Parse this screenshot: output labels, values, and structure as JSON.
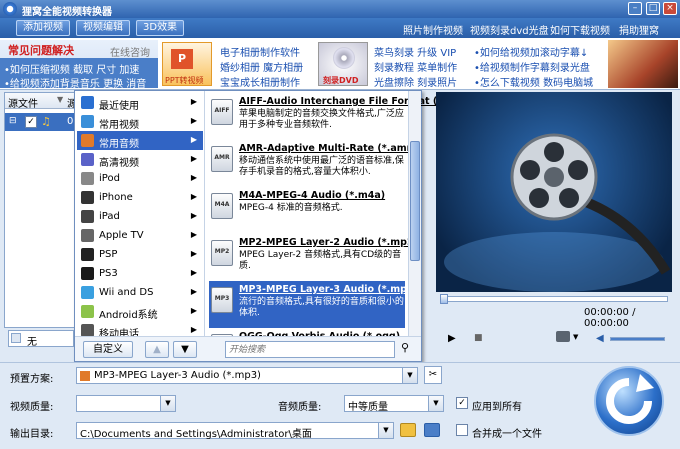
{
  "window": {
    "title": "狸窝全能视频转换器"
  },
  "menubar": {
    "tabs": [
      "添加视频",
      "视频编辑",
      "3D效果"
    ],
    "links": [
      "照片制作视频",
      "视频刻录dvd光盘",
      "如何下载视频",
      "捐助狸窝"
    ]
  },
  "ads": {
    "faq_title": "常见问题解决",
    "online": "在线咨询",
    "faq_lines": [
      "•如何压缩视频  截取  尺寸  加速",
      "•给视频添加背景音乐  更换  消音"
    ],
    "ppt_label": "PPT转视频",
    "mid_lines": [
      "电子相册制作软件",
      "婚纱相册  魔方相册",
      "宝宝成长相册制作"
    ],
    "dvd_label": "刻录DVD",
    "right_lines": [
      "菜鸟刻录  升级 VIP",
      "刻录教程  菜单制作",
      "光盘擦除  刻录照片"
    ],
    "far_lines": [
      "•如何给视频加滚动字幕↓",
      "•给视频制作字幕刻录光盘",
      "•怎么下载视频  数码电脑城"
    ]
  },
  "filelist": {
    "col1": "源文件",
    "col2": "源",
    "row_num": "0"
  },
  "subtitle": {
    "value": "无"
  },
  "categories": [
    {
      "label": "最近使用",
      "icon": "clock-icon"
    },
    {
      "label": "常用视频",
      "icon": "video-icon"
    },
    {
      "label": "常用音频",
      "icon": "audio-icon",
      "selected": true
    },
    {
      "label": "高清视频",
      "icon": "hd-icon"
    },
    {
      "label": "iPod",
      "icon": "ipod-icon"
    },
    {
      "label": "iPhone",
      "icon": "iphone-icon"
    },
    {
      "label": "iPad",
      "icon": "ipad-icon"
    },
    {
      "label": "Apple TV",
      "icon": "appletv-icon"
    },
    {
      "label": "PSP",
      "icon": "psp-icon"
    },
    {
      "label": "PS3",
      "icon": "ps3-icon"
    },
    {
      "label": "Wii and DS",
      "icon": "wii-icon"
    },
    {
      "label": "Android系统",
      "icon": "android-icon"
    },
    {
      "label": "移动电话",
      "icon": "phone-icon"
    }
  ],
  "formats": [
    {
      "badge": "AIFF",
      "title": "AIFF-Audio Interchange File Format (*.aiff)",
      "desc": "苹果电脑制定的音频交换文件格式,广泛应用于多种专业音频软件."
    },
    {
      "badge": "AMR",
      "title": "AMR-Adaptive Multi-Rate (*.amr)",
      "desc": "移动通信系统中使用最广泛的语音标准,保存手机录音的格式,容量大体积小."
    },
    {
      "badge": "M4A",
      "title": "M4A-MPEG-4 Audio (*.m4a)",
      "desc": "MPEG-4 标准的音频格式."
    },
    {
      "badge": "MP2",
      "title": "MP2-MPEG Layer-2 Audio (*.mp2)",
      "desc": "MPEG Layer-2 音频格式,具有CD级的音质."
    },
    {
      "badge": "MP3",
      "title": "MP3-MPEG Layer-3 Audio (*.mp3)",
      "desc": "流行的音频格式,具有很好的音质和很小的体积.",
      "selected": true
    },
    {
      "badge": "OGG",
      "title": "OGG-Ogg Vorbis Audio (*.ogg)",
      "desc": ""
    }
  ],
  "popup_footer": {
    "custom": "自定义",
    "up": "▲",
    "down": "▼",
    "search_placeholder": "开始搜索"
  },
  "player": {
    "time": "00:00:00 / 00:00:00"
  },
  "settings": {
    "preset_label": "预置方案:",
    "preset_value": "MP3-MPEG Layer-3 Audio (*.mp3)",
    "vq_label": "视频质量:",
    "vq_value": "",
    "aq_label": "音频质量:",
    "aq_value": "中等质量",
    "apply_all": "应用到所有",
    "out_label": "输出目录:",
    "out_value": "C:\\Documents and Settings\\Administrator\\桌面",
    "merge": "合并成一个文件"
  },
  "colors": {
    "accent": "#3164c4",
    "titlebar": "#2f64b0"
  }
}
